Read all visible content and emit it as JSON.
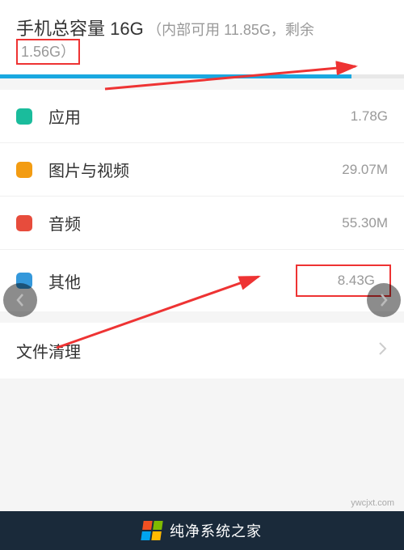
{
  "header": {
    "title": "手机总容量 16G",
    "detail_prefix": "（内部可用 11.85G，剩余",
    "remaining": "1.56G）"
  },
  "storage": {
    "used_percent": 87
  },
  "categories": [
    {
      "label": "应用",
      "value": "1.78G",
      "color": "green"
    },
    {
      "label": "图片与视频",
      "value": "29.07M",
      "color": "orange"
    },
    {
      "label": "音频",
      "value": "55.30M",
      "color": "red"
    },
    {
      "label": "其他",
      "value": "8.43G",
      "color": "blue",
      "highlight": true
    }
  ],
  "clean": {
    "label": "文件清理"
  },
  "footer": {
    "brand": "纯净系统之家"
  },
  "watermark": "ywcjxt.com"
}
